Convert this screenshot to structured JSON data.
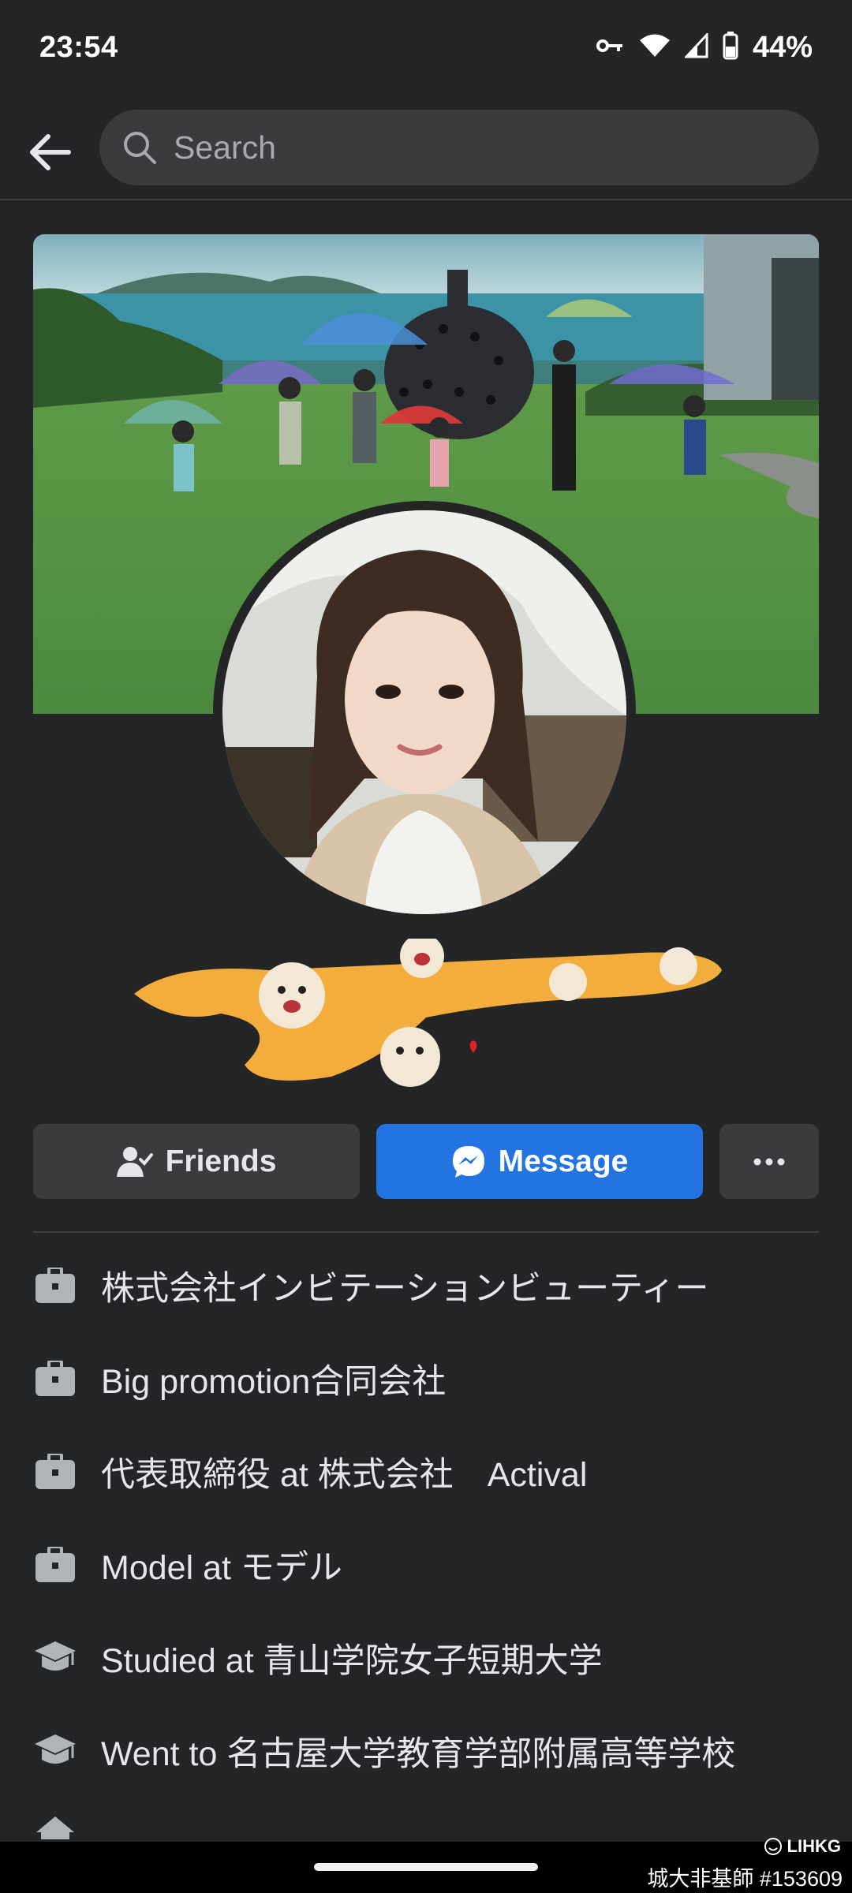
{
  "status_bar": {
    "time": "23:54",
    "battery_percent": "44%",
    "icons": [
      "vpn-key-icon",
      "wifi-icon",
      "signal-icon",
      "battery-icon"
    ]
  },
  "search": {
    "placeholder": "Search"
  },
  "actions": {
    "friends_label": "Friends",
    "message_label": "Message"
  },
  "intro": {
    "items": [
      {
        "icon": "briefcase-icon",
        "text": "株式会社インビテーションビューティー"
      },
      {
        "icon": "briefcase-icon",
        "text": "Big promotion合同会社"
      },
      {
        "icon": "briefcase-icon",
        "text": "代表取締役 at 株式会社　Actival"
      },
      {
        "icon": "briefcase-icon",
        "text": "Model at モデル"
      },
      {
        "icon": "graduation-cap-icon",
        "text": "Studied at 青山学院女子短期大学"
      },
      {
        "icon": "graduation-cap-icon",
        "text": "Went to 名古屋大学教育学部附属高等学校"
      }
    ]
  },
  "watermark": {
    "brand": "LIHKG",
    "caption": "城大非基師 #153609"
  },
  "colors": {
    "background": "#242526",
    "button_secondary": "#3a3b3c",
    "button_primary": "#2374e1",
    "text_primary": "#e4e6eb"
  }
}
